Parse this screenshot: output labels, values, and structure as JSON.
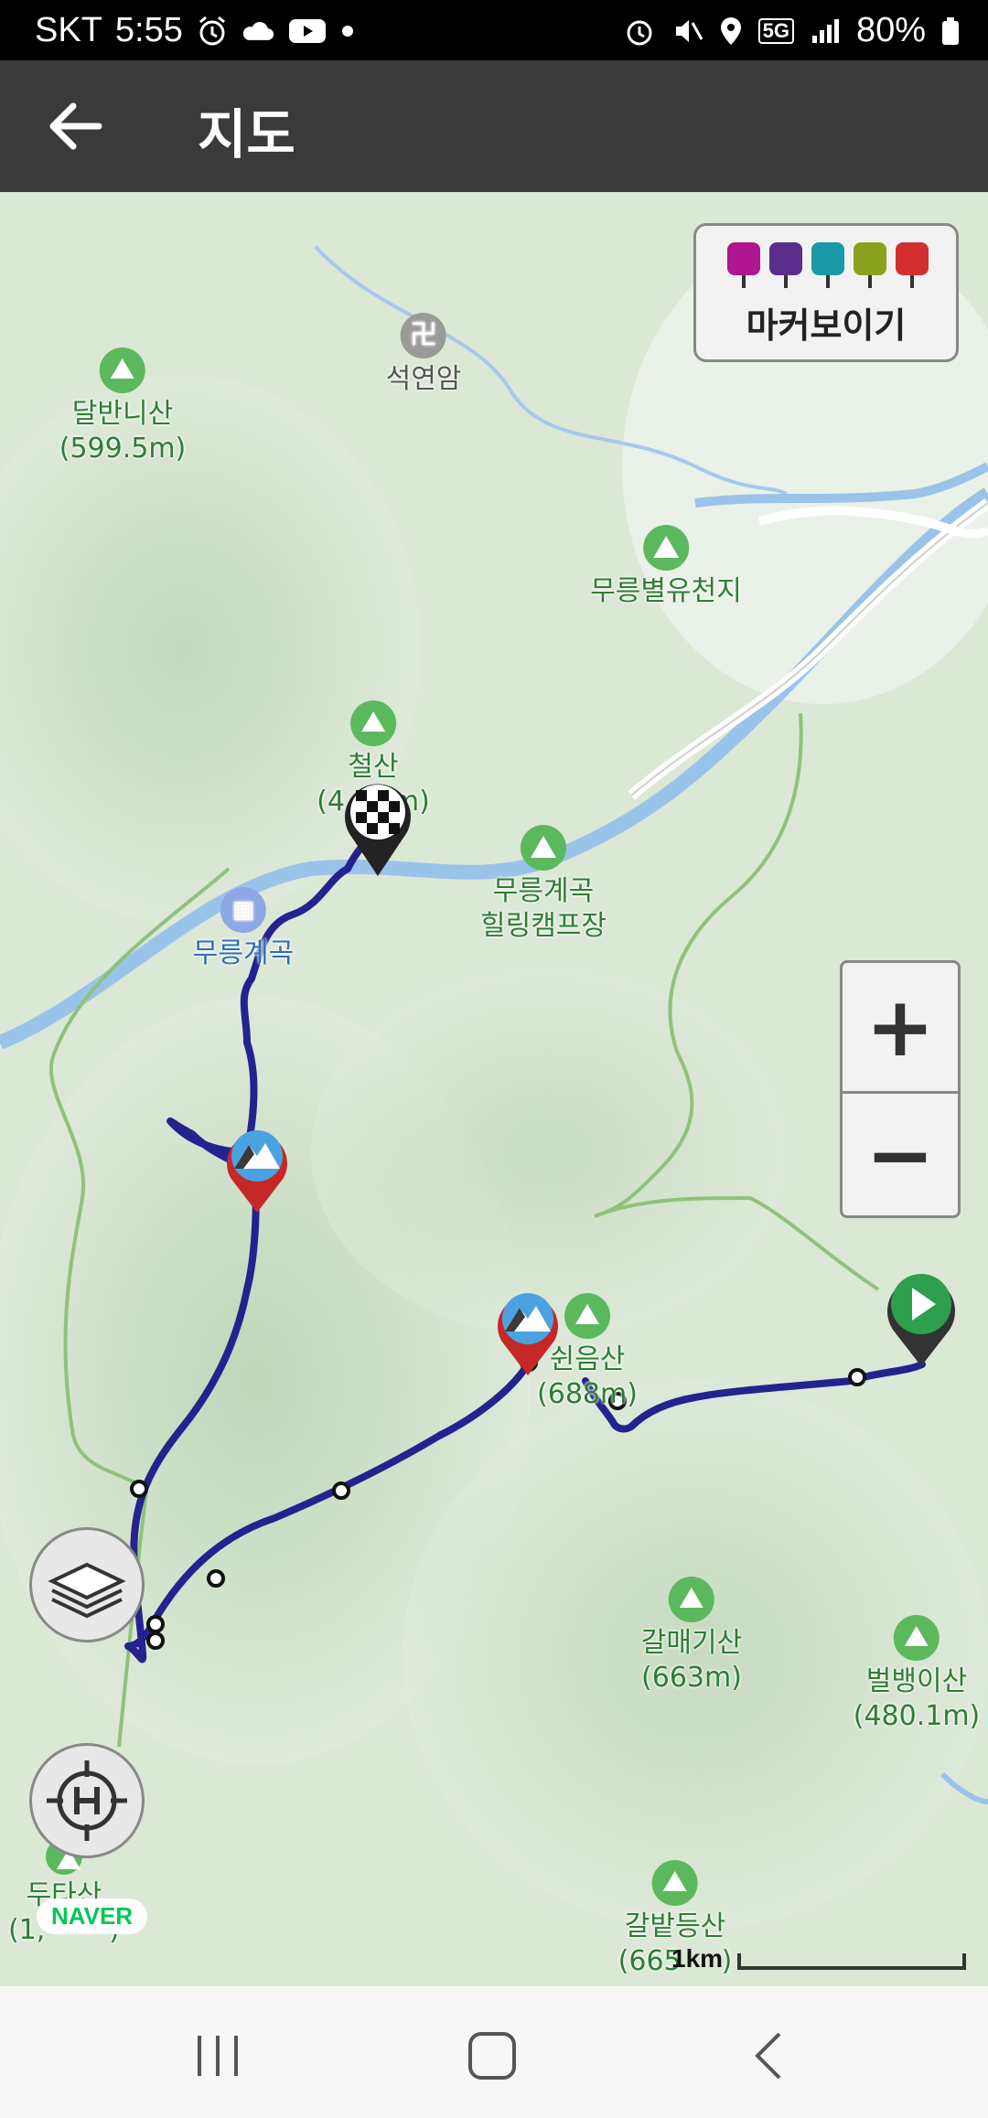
{
  "status_bar": {
    "carrier": "SKT",
    "time": "5:55",
    "network": "5G",
    "battery": "80%",
    "icons": [
      "alarm-icon",
      "cloud-icon",
      "youtube-icon",
      "dot-icon",
      "alarm-icon",
      "mute-icon",
      "location-icon",
      "signal-icon",
      "battery-icon"
    ]
  },
  "app_bar": {
    "title": "지도",
    "back_icon": "arrow-left-icon"
  },
  "marker_toggle": {
    "label": "마커보이기",
    "icon_colors": [
      "#b0168f",
      "#5a2d8c",
      "#1a9aa6",
      "#8aa21e",
      "#d32f2f"
    ],
    "icons": [
      "camera-icon",
      "video-icon",
      "mic-icon",
      "memo-icon",
      "flag-icon"
    ]
  },
  "map": {
    "pois": [
      {
        "name": "석연암",
        "type": "temple"
      },
      {
        "name": "달반니산",
        "height": "(599.5m)",
        "type": "peak"
      },
      {
        "name": "무릉별유천지",
        "type": "park"
      },
      {
        "name": "철산",
        "height": "(4",
        "height_end": "m)",
        "type": "peak"
      },
      {
        "name": "무릉계곡",
        "height": "힐링캠프장",
        "type": "camp"
      },
      {
        "name": "무릉계곡",
        "type": "landmark"
      },
      {
        "name": "쉰음산",
        "height": "(688m)",
        "type": "peak"
      },
      {
        "name": "갈매기산",
        "height": "(663m)",
        "type": "peak"
      },
      {
        "name": "벌뱅이산",
        "height": "(480.1m)",
        "type": "peak"
      },
      {
        "name": "두타산",
        "height": "(1,",
        "height_end": ")",
        "type": "peak"
      },
      {
        "name": "갈밭등산",
        "height": "(665",
        "height_end": ")",
        "type": "peak"
      }
    ],
    "route_color": "#23238f",
    "start_marker_color": "#2e9e4f",
    "finish_marker": "checkered-flag"
  },
  "zoom": {
    "in": "+",
    "out": "−"
  },
  "layers_button": "layers-icon",
  "home_button": "crosshair-h-icon",
  "attribution": "NAVER",
  "scale_label": "1km",
  "nav_bar": {
    "recent": "recent-apps-icon",
    "home": "home-icon",
    "back": "back-icon"
  }
}
